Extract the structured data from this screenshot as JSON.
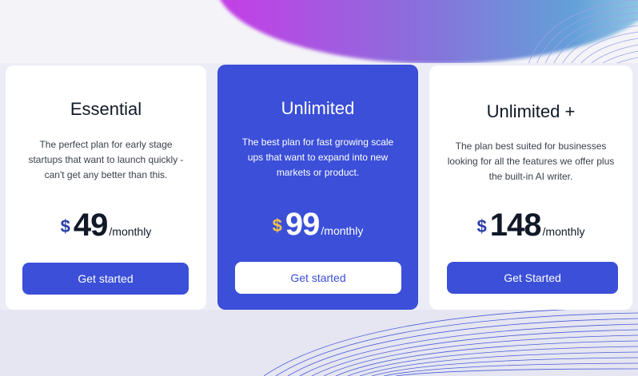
{
  "plans": [
    {
      "title": "Essential",
      "description": "The perfect plan for early stage startups that want to launch quickly - can't get any better than this.",
      "currency": "$",
      "amount": "49",
      "period": "/monthly",
      "cta": "Get started"
    },
    {
      "title": "Unlimited",
      "description": "The best plan for fast growing scale ups that want to expand into new markets or product.",
      "currency": "$",
      "amount": "99",
      "period": "/monthly",
      "cta": "Get started"
    },
    {
      "title": "Unlimited +",
      "description": "The plan best suited for businesses looking for all the features we offer plus the built-in AI writer.",
      "currency": "$",
      "amount": "148",
      "period": "/monthly",
      "cta": "Get Started"
    }
  ],
  "colors": {
    "accent": "#3b4fd8",
    "featured_currency": "#f2c24a",
    "currency": "#2a3ea8"
  }
}
